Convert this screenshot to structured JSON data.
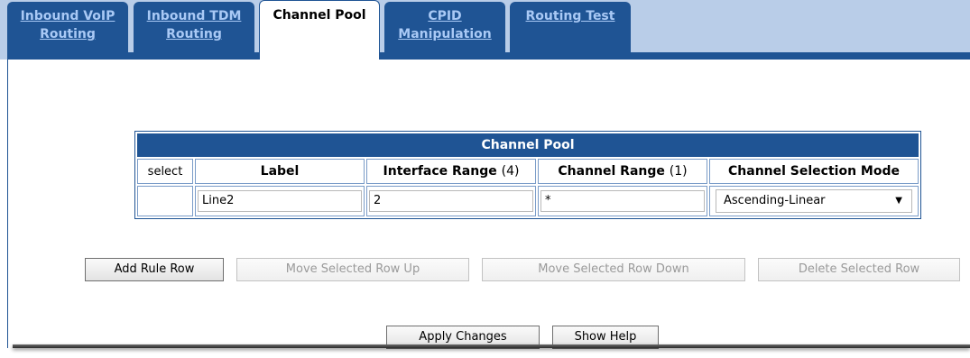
{
  "tabs": [
    {
      "label_line1": "Inbound VoIP",
      "label_line2": "Routing"
    },
    {
      "label_line1": "Inbound TDM",
      "label_line2": "Routing"
    },
    {
      "label_line1": "Channel Pool",
      "label_line2": ""
    },
    {
      "label_line1": "CPID",
      "label_line2": "Manipulation"
    },
    {
      "label_line1": "Routing Test",
      "label_line2": ""
    }
  ],
  "active_tab": "Channel Pool",
  "table": {
    "caption": "Channel Pool",
    "headers": {
      "select": "select",
      "label": "Label",
      "interface_range": "Interface Range",
      "interface_range_hint": "(4)",
      "channel_range": "Channel Range",
      "channel_range_hint": "(1)",
      "selection_mode": "Channel Selection Mode"
    },
    "rows": [
      {
        "label": "Line2",
        "interface_range": "2",
        "channel_range": "*",
        "selection_mode": "Ascending-Linear"
      }
    ]
  },
  "buttons": {
    "add_rule_row": "Add Rule Row",
    "move_up": "Move Selected Row Up",
    "move_down": "Move Selected Row Down",
    "delete_row": "Delete Selected Row",
    "apply_changes": "Apply Changes",
    "show_help": "Show Help"
  },
  "colors": {
    "tab_blue": "#1f5494",
    "tab_text": "#a9c9f5",
    "tabbar_bg": "#b9cde8"
  }
}
